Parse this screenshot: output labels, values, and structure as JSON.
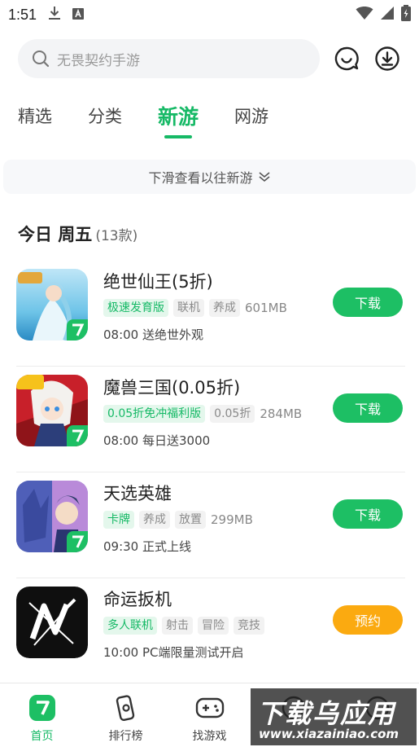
{
  "status_bar": {
    "time": "1:51"
  },
  "search": {
    "placeholder": "无畏契约手游"
  },
  "tabs": [
    {
      "label": "精选",
      "active": false
    },
    {
      "label": "分类",
      "active": false
    },
    {
      "label": "新游",
      "active": true
    },
    {
      "label": "网游",
      "active": false
    }
  ],
  "pull_hint": {
    "text": "下滑查看以往新游"
  },
  "section": {
    "title": "今日 周五",
    "count": "(13款)"
  },
  "games": [
    {
      "name": "绝世仙王(5折)",
      "tags": [
        "极速发育版",
        "联机",
        "养成"
      ],
      "green_tags": 1,
      "size": "601MB",
      "time": "08:00",
      "desc": "送绝世外观",
      "action": "下载",
      "action_color": "#1dbf64"
    },
    {
      "name": "魔兽三国(0.05折)",
      "tags": [
        "0.05折免冲福利版",
        "0.05折"
      ],
      "green_tags": 1,
      "size": "284MB",
      "time": "08:00",
      "desc": "每日送3000",
      "action": "下载",
      "action_color": "#1dbf64"
    },
    {
      "name": "天选英雄",
      "tags": [
        "卡牌",
        "养成",
        "放置"
      ],
      "green_tags": 1,
      "size": "299MB",
      "time": "09:30",
      "desc": "正式上线",
      "action": "下载",
      "action_color": "#1dbf64"
    },
    {
      "name": "命运扳机",
      "tags": [
        "多人联机",
        "射击",
        "冒险",
        "竞技"
      ],
      "green_tags": 1,
      "size": "",
      "time": "10:00",
      "desc": "PC端限量测试开启",
      "action": "预约",
      "action_color": "#fbaa10"
    }
  ],
  "bottom_nav": [
    {
      "label": "首页",
      "active": true
    },
    {
      "label": "排行榜",
      "active": false
    },
    {
      "label": "找游戏",
      "active": false
    },
    {
      "label": "",
      "active": false
    },
    {
      "label": "",
      "active": false
    }
  ],
  "watermark": {
    "title": "下载乌应用",
    "url": "www.xiazainiao.com"
  },
  "colors": {
    "accent": "#16b966",
    "download": "#1dbf64",
    "reserve": "#fbaa10"
  }
}
